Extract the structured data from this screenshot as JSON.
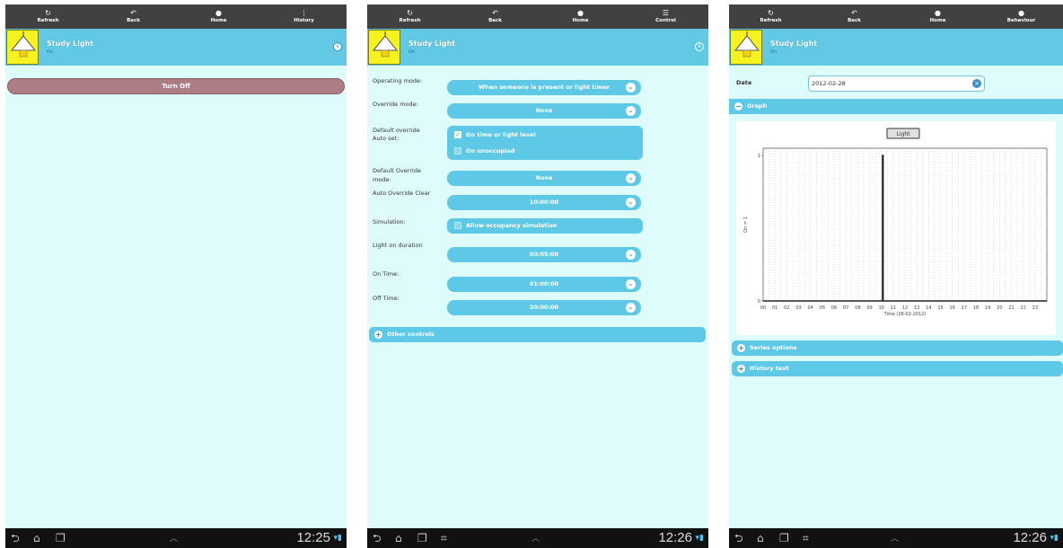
{
  "phone1": {
    "toolbar": [
      {
        "label": "Refresh",
        "icon": "refresh-icon"
      },
      {
        "label": "Back",
        "icon": "back-icon"
      },
      {
        "label": "Home",
        "icon": "home-icon"
      },
      {
        "label": "History",
        "icon": "history-icon"
      }
    ],
    "device": {
      "title": "Study Light",
      "status": "On"
    },
    "turn_off_label": "Turn Off",
    "clock": "12:25"
  },
  "phone2": {
    "toolbar": [
      {
        "label": "Refresh",
        "icon": "refresh-icon"
      },
      {
        "label": "Back",
        "icon": "back-icon"
      },
      {
        "label": "Home",
        "icon": "home-icon"
      },
      {
        "label": "Control",
        "icon": "control-icon"
      }
    ],
    "device": {
      "title": "Study Light",
      "status": "On"
    },
    "operating_mode": {
      "label": "Operating mode:",
      "value": "When someone is present or light timer"
    },
    "override_mode": {
      "label": "Override mode:",
      "value": "None"
    },
    "default_override_auto_set": {
      "label_line1": "Default override",
      "label_line2": "Auto set:",
      "option1": {
        "label": "On time or light level",
        "checked": true
      },
      "option2": {
        "label": "On unoccupied",
        "checked": false
      }
    },
    "default_override_mode": {
      "label_line1": "Default Override",
      "label_line2": "mode:",
      "value": "None"
    },
    "auto_override_clear": {
      "label": "Auto Override Clear",
      "value": "10:00:00"
    },
    "simulation": {
      "label": "Simulation:",
      "option_label": "Allow occupancy simulation",
      "checked": false
    },
    "light_on_duration": {
      "label": "Light on duration",
      "value": "00:05:00"
    },
    "on_time": {
      "label": "On Time:",
      "value": "01:00:00"
    },
    "off_time": {
      "label": "Off Time:",
      "value": "20:00:00"
    },
    "other_controls_label": "Other controls",
    "clock": "12:26"
  },
  "phone3": {
    "toolbar": [
      {
        "label": "Refresh",
        "icon": "refresh-icon"
      },
      {
        "label": "Back",
        "icon": "back-icon"
      },
      {
        "label": "Home",
        "icon": "home-icon"
      },
      {
        "label": "Behaviour",
        "icon": "behaviour-icon"
      }
    ],
    "device": {
      "title": "Study Light",
      "status": "On"
    },
    "date_label": "Date",
    "date_value": "2012-02-28",
    "graph_section_label": "Graph",
    "series_options_label": "Series options",
    "history_text_label": "History text",
    "clock": "12:26",
    "chart_data": {
      "type": "line",
      "legend": [
        "Light"
      ],
      "legend_placement": "top-center",
      "xlabel": "Time (28-02-2012)",
      "ylabel": "On = 1",
      "x_tick_labels": [
        "00",
        "01",
        "02",
        "03",
        "04",
        "05",
        "06",
        "07",
        "08",
        "09",
        "10",
        "11",
        "12",
        "13",
        "14",
        "15",
        "16",
        "17",
        "18",
        "19",
        "20",
        "21",
        "22",
        "23"
      ],
      "y_tick_labels": [
        "0",
        "1"
      ],
      "xlim": [
        0,
        24
      ],
      "ylim": [
        0,
        1
      ],
      "grid": true,
      "series": [
        {
          "name": "Light",
          "x": [
            0,
            10.1,
            10.1,
            10.15,
            10.15,
            24
          ],
          "y": [
            0,
            0,
            1,
            1,
            0,
            0
          ]
        }
      ]
    }
  },
  "colors": {
    "toolbar_bg": "#414141",
    "title_bar": "#62c9e5",
    "background": "#dffcfc",
    "turn_off_button": "#ad7d85",
    "bulb": "#f5f220"
  }
}
